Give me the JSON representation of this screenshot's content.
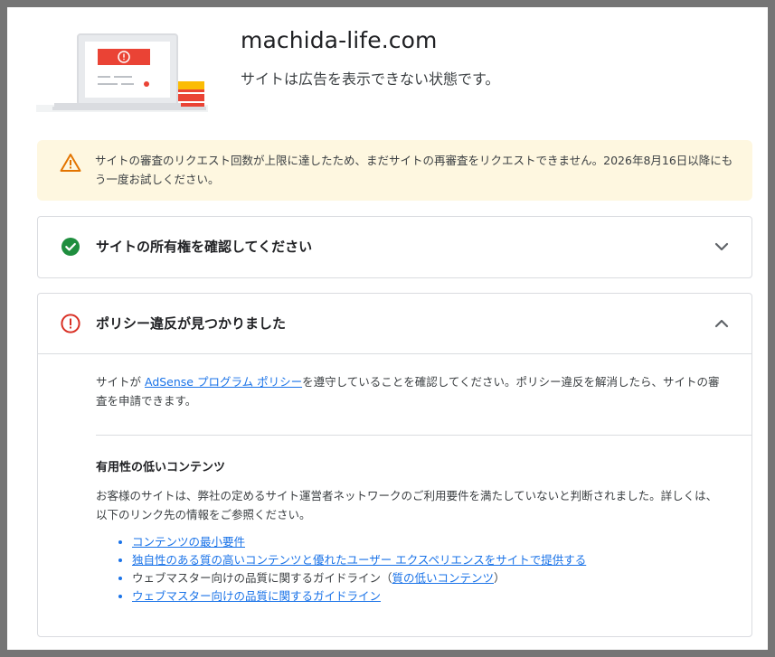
{
  "header": {
    "site_name": "machida-life.com",
    "site_status": "サイトは広告を表示できない状態です。"
  },
  "banner": {
    "icon": "warning-icon",
    "text": "サイトの審査のリクエスト回数が上限に達したため、まだサイトの再審査をリクエストできません。2026年8月16日以降にもう一度お試しください。"
  },
  "cards": {
    "ownership": {
      "icon": "check-circle-icon",
      "title": "サイトの所有権を確認してください",
      "chevron": "chevron-down-icon"
    },
    "policy": {
      "icon": "error-icon",
      "title": "ポリシー違反が見つかりました",
      "chevron": "chevron-up-icon",
      "intro_prefix": "サイトが ",
      "intro_link": "AdSense プログラム ポリシー",
      "intro_suffix": "を遵守していることを確認してください。ポリシー違反を解消したら、サイトの審査を申請できます。",
      "section_title": "有用性の低いコンテンツ",
      "section_body": "お客様のサイトは、弊社の定めるサイト運営者ネットワークのご利用要件を満たしていないと判断されました。詳しくは、以下のリンク先の情報をご参照ください。",
      "links": [
        {
          "text": "コンテンツの最小要件"
        },
        {
          "text": "独自性のある質の高いコンテンツと優れたユーザー エクスペリエンスをサイトで提供する"
        },
        {
          "prefix": "ウェブマスター向けの品質に関するガイドライン（",
          "link": "質の低いコンテンツ",
          "suffix": "）"
        },
        {
          "text": "ウェブマスター向けの品質に関するガイドライン"
        }
      ]
    }
  },
  "colors": {
    "accent": "#1a73e8",
    "success": "#1e8e3e",
    "error": "#d93025",
    "warning": "#e37400",
    "banner_bg": "#fef7e0"
  }
}
